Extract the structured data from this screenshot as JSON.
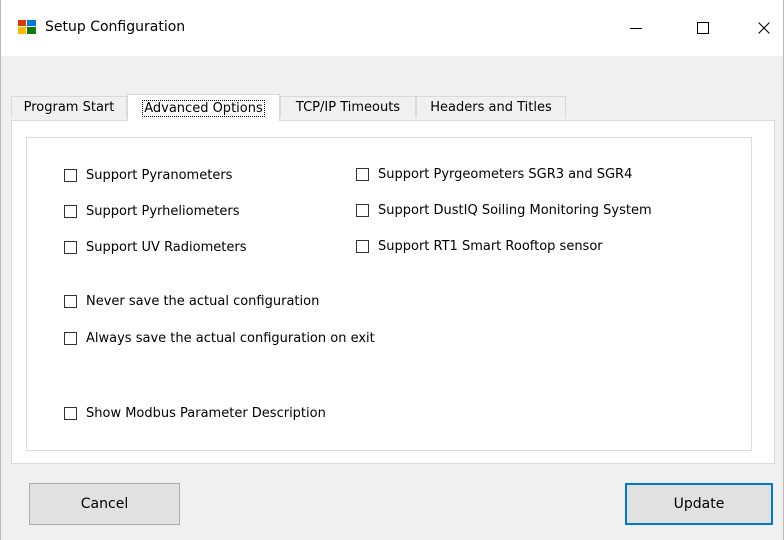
{
  "window": {
    "title": "Setup Configuration",
    "icon": "setup-app-icon"
  },
  "tabs": [
    {
      "label": "Program Start",
      "active": false
    },
    {
      "label": "Advanced Options",
      "active": true
    },
    {
      "label": "TCP/IP Timeouts",
      "active": false
    },
    {
      "label": "Headers and Titles",
      "active": false
    }
  ],
  "options": {
    "support_pyranometers": {
      "label": "Support Pyranometers",
      "checked": false
    },
    "support_pyrheliometers": {
      "label": "Support Pyrheliometers",
      "checked": false
    },
    "support_uv_radiometers": {
      "label": "Support UV Radiometers",
      "checked": false
    },
    "support_pyrgeometers": {
      "label": "Support Pyrgeometers SGR3 and SGR4",
      "checked": false
    },
    "support_dustiq": {
      "label": "Support DustIQ Soiling Monitoring System",
      "checked": false
    },
    "support_rt1": {
      "label": "Support RT1 Smart Rooftop sensor",
      "checked": false
    },
    "never_save": {
      "label": "Never save the actual configuration",
      "checked": false
    },
    "always_save": {
      "label": "Always save the actual configuration on exit",
      "checked": false
    },
    "show_modbus": {
      "label": "Show Modbus Parameter Description",
      "checked": false
    }
  },
  "buttons": {
    "cancel": "Cancel",
    "update": "Update"
  },
  "colors": {
    "focus_border": "#0078d7",
    "button_face": "#e1e1e1",
    "window_bg": "#f0f0f0"
  }
}
